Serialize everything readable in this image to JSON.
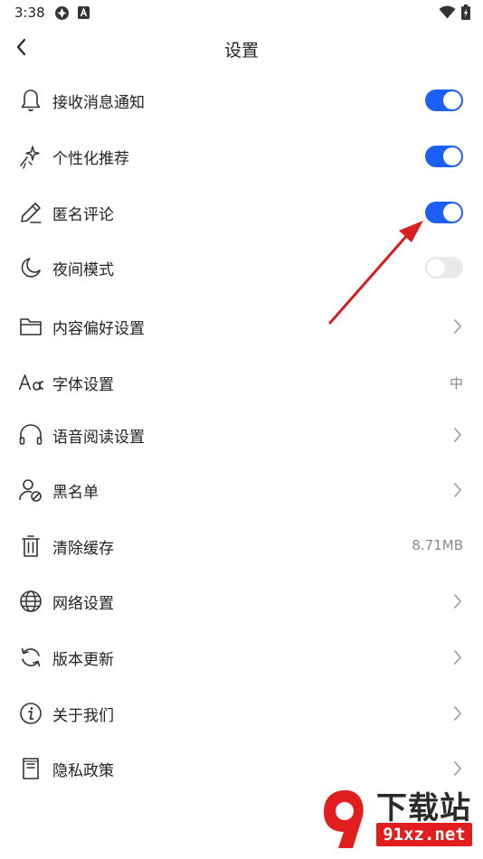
{
  "status_bar": {
    "time": "3:38"
  },
  "header": {
    "title": "设置"
  },
  "settings": [
    {
      "label": "接收消息通知",
      "icon": "bell-icon",
      "control": "toggle",
      "on": true
    },
    {
      "label": "个性化推荐",
      "icon": "sparkle-icon",
      "control": "toggle",
      "on": true
    },
    {
      "label": "匿名评论",
      "icon": "pen-icon",
      "control": "toggle",
      "on": true
    },
    {
      "label": "夜间模式",
      "icon": "moon-icon",
      "control": "toggle",
      "on": false
    },
    {
      "label": "内容偏好设置",
      "icon": "folder-icon",
      "control": "chevron"
    },
    {
      "label": "字体设置",
      "icon": "font-icon",
      "control": "value",
      "value": "中"
    },
    {
      "label": "语音阅读设置",
      "icon": "headphones-icon",
      "control": "chevron"
    },
    {
      "label": "黑名单",
      "icon": "user-block-icon",
      "control": "chevron"
    },
    {
      "label": "清除缓存",
      "icon": "trash-icon",
      "control": "value",
      "value": "8.71MB"
    },
    {
      "label": "网络设置",
      "icon": "globe-icon",
      "control": "chevron"
    },
    {
      "label": "版本更新",
      "icon": "refresh-icon",
      "control": "chevron"
    },
    {
      "label": "关于我们",
      "icon": "info-icon",
      "control": "chevron"
    },
    {
      "label": "隐私政策",
      "icon": "document-icon",
      "control": "chevron"
    }
  ],
  "colors": {
    "accent": "#1b5ff5",
    "toggle_off": "#e9e9e9",
    "annotation_arrow": "#d81e1e",
    "watermark_red": "#e11d1d"
  },
  "watermark": {
    "title": "下载站",
    "domain": "91xz.net",
    "logo_text": "9"
  }
}
